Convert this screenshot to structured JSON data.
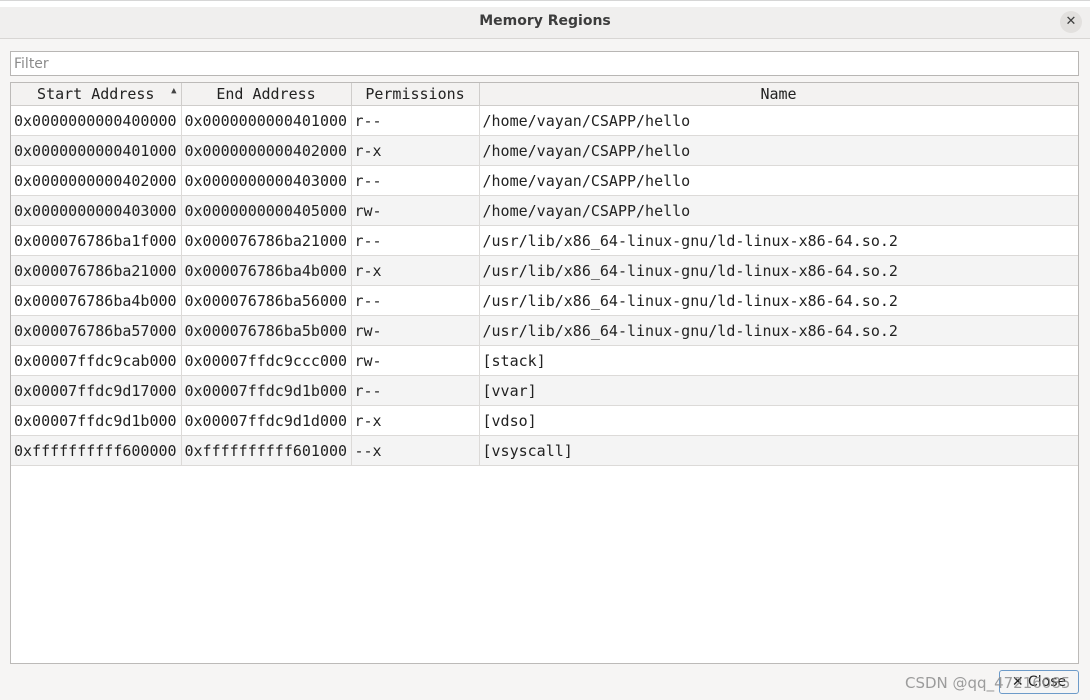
{
  "window": {
    "title": "Memory Regions",
    "close_icon": "close-icon"
  },
  "filter": {
    "placeholder": "Filter",
    "value": ""
  },
  "table": {
    "columns": [
      "Start Address",
      "End Address",
      "Permissions",
      "Name"
    ],
    "sorted_column": "Start Address",
    "sort_direction": "ascending",
    "rows": [
      [
        "0x0000000000400000",
        "0x0000000000401000",
        "r--",
        "/home/vayan/CSAPP/hello"
      ],
      [
        "0x0000000000401000",
        "0x0000000000402000",
        "r-x",
        "/home/vayan/CSAPP/hello"
      ],
      [
        "0x0000000000402000",
        "0x0000000000403000",
        "r--",
        "/home/vayan/CSAPP/hello"
      ],
      [
        "0x0000000000403000",
        "0x0000000000405000",
        "rw-",
        "/home/vayan/CSAPP/hello"
      ],
      [
        "0x000076786ba1f000",
        "0x000076786ba21000",
        "r--",
        "/usr/lib/x86_64-linux-gnu/ld-linux-x86-64.so.2"
      ],
      [
        "0x000076786ba21000",
        "0x000076786ba4b000",
        "r-x",
        "/usr/lib/x86_64-linux-gnu/ld-linux-x86-64.so.2"
      ],
      [
        "0x000076786ba4b000",
        "0x000076786ba56000",
        "r--",
        "/usr/lib/x86_64-linux-gnu/ld-linux-x86-64.so.2"
      ],
      [
        "0x000076786ba57000",
        "0x000076786ba5b000",
        "rw-",
        "/usr/lib/x86_64-linux-gnu/ld-linux-x86-64.so.2"
      ],
      [
        "0x00007ffdc9cab000",
        "0x00007ffdc9ccc000",
        "rw-",
        "[stack]"
      ],
      [
        "0x00007ffdc9d17000",
        "0x00007ffdc9d1b000",
        "r--",
        "[vvar]"
      ],
      [
        "0x00007ffdc9d1b000",
        "0x00007ffdc9d1d000",
        "r-x",
        "[vdso]"
      ],
      [
        "0xffffffffff600000",
        "0xffffffffff601000",
        "--x",
        "[vsyscall]"
      ]
    ]
  },
  "footer": {
    "close_label": "Close",
    "close_icon": "close-icon",
    "watermark": "CSDN @qq_47216085"
  },
  "colors": {
    "focus_border": "#6d9bc9",
    "row_alt": "#f4f4f4",
    "header_bg": "#f3f2f1"
  }
}
